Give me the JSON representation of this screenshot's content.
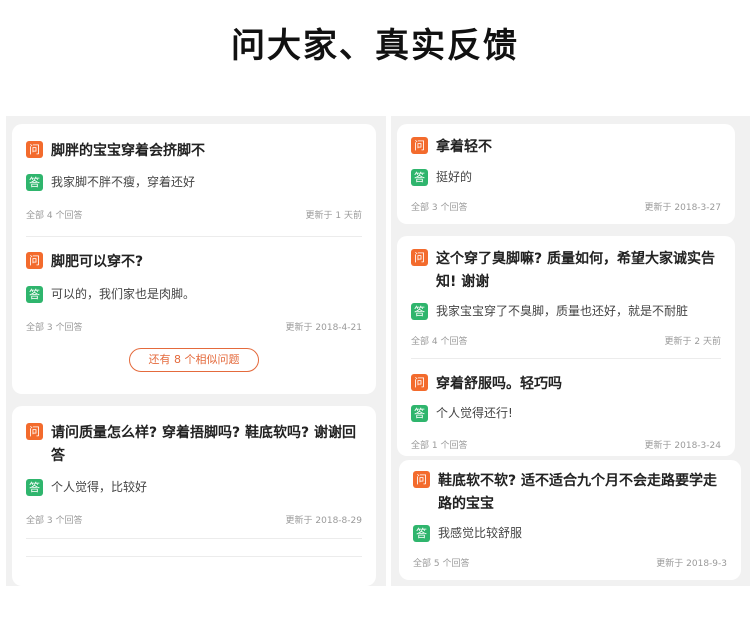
{
  "header": {
    "title": "问大家、真实反馈"
  },
  "badges": {
    "question": "问",
    "answer": "答"
  },
  "left_cards": [
    {
      "items": [
        {
          "question": "脚胖的宝宝穿着会挤脚不",
          "answer": "我家脚不胖不瘦，穿着还好",
          "count": "全部 4 个回答",
          "updated": "更新于 1 天前"
        },
        {
          "question": "脚肥可以穿不?",
          "answer": "可以的，我们家也是肉脚。",
          "count": "全部 3 个回答",
          "updated": "更新于 2018-4-21"
        }
      ],
      "more_label": "还有 8 个相似问题"
    },
    {
      "items": [
        {
          "question": "请问质量怎么样? 穿着捂脚吗? 鞋底软吗? 谢谢回答",
          "answer": "个人觉得，比较好",
          "count": "全部 3 个回答",
          "updated": "更新于 2018-8-29"
        }
      ]
    }
  ],
  "right_cards": [
    {
      "items": [
        {
          "question": "拿着轻不",
          "answer": "挺好的",
          "count": "全部 3 个回答",
          "updated": "更新于 2018-3-27"
        }
      ]
    },
    {
      "items": [
        {
          "question": "这个穿了臭脚嘛? 质量如何，希望大家诚实告知! 谢谢",
          "answer": "我家宝宝穿了不臭脚，质量也还好，就是不耐脏",
          "count": "全部 4 个回答",
          "updated": "更新于 2 天前"
        },
        {
          "question": "穿着舒服吗。轻巧吗",
          "answer": "个人觉得还行!",
          "count": "全部 1 个回答",
          "updated": "更新于 2018-3-24"
        }
      ]
    },
    {
      "items": [
        {
          "question": "鞋底软不软? 适不适合九个月不会走路要学走路的宝宝",
          "answer": "我感觉比较舒服",
          "count": "全部 5 个回答",
          "updated": "更新于 2018-9-3"
        }
      ]
    }
  ]
}
